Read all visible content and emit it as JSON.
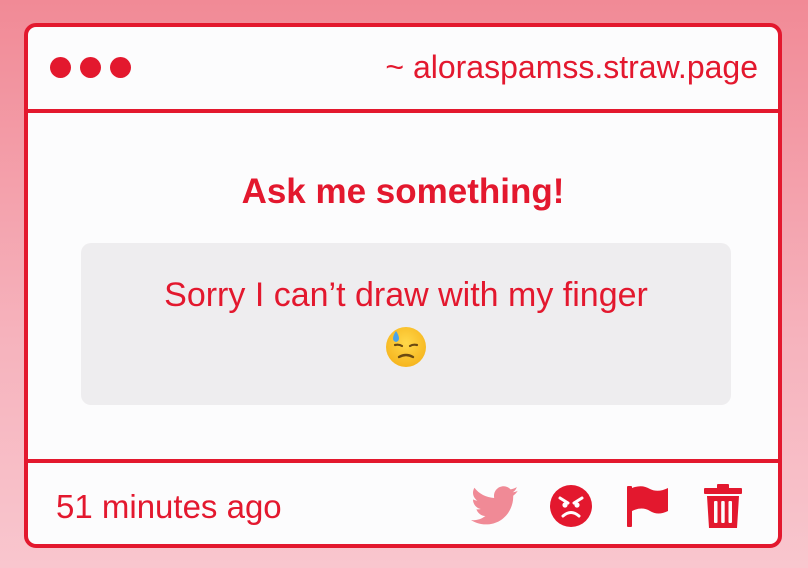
{
  "window": {
    "url": "~ aloraspamss.straw.page"
  },
  "main": {
    "heading": "Ask me something!",
    "answer": "Sorry I can’t draw with my finger",
    "answer_emoji": "downcast-face-with-sweat-emoji"
  },
  "footer": {
    "timestamp": "51 minutes ago",
    "actions": [
      {
        "icon": "twitter-bird-icon"
      },
      {
        "icon": "angry-face-icon"
      },
      {
        "icon": "flag-icon"
      },
      {
        "icon": "trash-icon"
      }
    ]
  },
  "colors": {
    "accent": "#e3182e",
    "twitter_pink": "#f08a96",
    "answer_bg": "#eeedef",
    "page_bg_top": "#f18a96",
    "page_bg_bottom": "#f9c6ce"
  }
}
